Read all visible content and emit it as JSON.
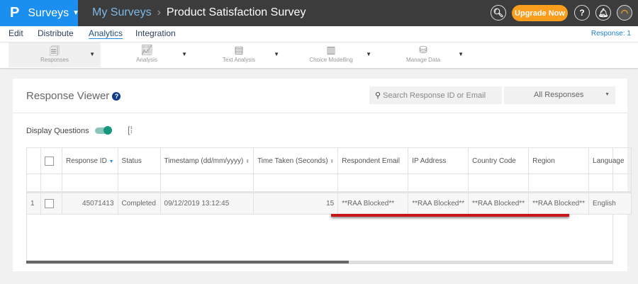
{
  "header": {
    "logo": "P",
    "app": "Surveys",
    "breadcrumb": {
      "parent": "My Surveys",
      "current": "Product Satisfaction Survey"
    },
    "upgrade_label": "Upgrade Now",
    "help": "?"
  },
  "nav": {
    "items": [
      {
        "label": "Edit"
      },
      {
        "label": "Distribute"
      },
      {
        "label": "Analytics",
        "active": true
      },
      {
        "label": "Integration"
      }
    ],
    "response_count": "Response: 1"
  },
  "toolbar": {
    "items": [
      {
        "label": "Responses",
        "selected": true
      },
      {
        "label": "Analysis"
      },
      {
        "label": "Text Analysis"
      },
      {
        "label": "Choice Modelling"
      },
      {
        "label": "Manage Data"
      }
    ]
  },
  "viewer": {
    "title": "Response Viewer",
    "help": "?",
    "search_placeholder": "Search Response ID or Email",
    "filter": "All Responses",
    "display_questions": "Display Questions",
    "display_questions_on": true
  },
  "table": {
    "columns": [
      "Response ID",
      "Status",
      "Timestamp (dd/mm/yyyy)",
      "Time Taken (Seconds)",
      "Respondent Email",
      "IP Address",
      "Country Code",
      "Region",
      "Language"
    ],
    "rows": [
      {
        "num": "1",
        "id": "45071413",
        "status": "Completed",
        "timestamp": "09/12/2019 13:12:45",
        "time": "15",
        "email": "**RAA Blocked**",
        "ip": "**RAA Blocked**",
        "country": "**RAA Blocked**",
        "region": "**RAA Blocked**",
        "language": "English"
      }
    ]
  },
  "colors": {
    "brand": "#1b8ff0",
    "topbar": "#3c3c3c",
    "upgrade": "#f99d1c",
    "toggle": "#13987d",
    "highlight": "#c8141b"
  }
}
